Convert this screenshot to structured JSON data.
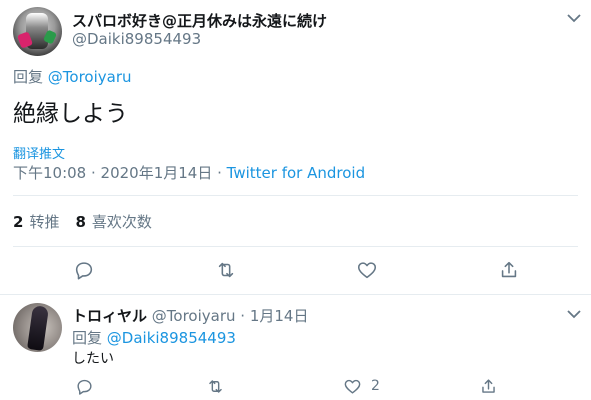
{
  "main_tweet": {
    "display_name": "スパロボ好き@正月休みは永遠に続け",
    "handle": "@Daiki89854493",
    "reply_prefix": "回复",
    "reply_to_handle": "@Toroiyaru",
    "text": "絶縁しよう",
    "translate_label": "翻译推文",
    "timestamp": "下午10:08 · 2020年1月14日 · ",
    "source": "Twitter for Android",
    "retweet_count": "2",
    "retweet_label": "转推",
    "like_count": "8",
    "like_label": "喜欢次数"
  },
  "reply_tweet": {
    "display_name": "トロィヤル",
    "handle_date": "@Toroiyaru · 1月14日",
    "reply_prefix": "回复",
    "reply_to_handle": "@Daiki89854493",
    "text": "したい",
    "like_count": "2"
  },
  "colors": {
    "text": "#14171a",
    "secondary": "#657786",
    "link": "#1b95e0",
    "divider": "#e6ecf0"
  },
  "icons": [
    "chevron-down-icon",
    "reply-icon",
    "retweet-icon",
    "like-icon",
    "share-icon"
  ]
}
